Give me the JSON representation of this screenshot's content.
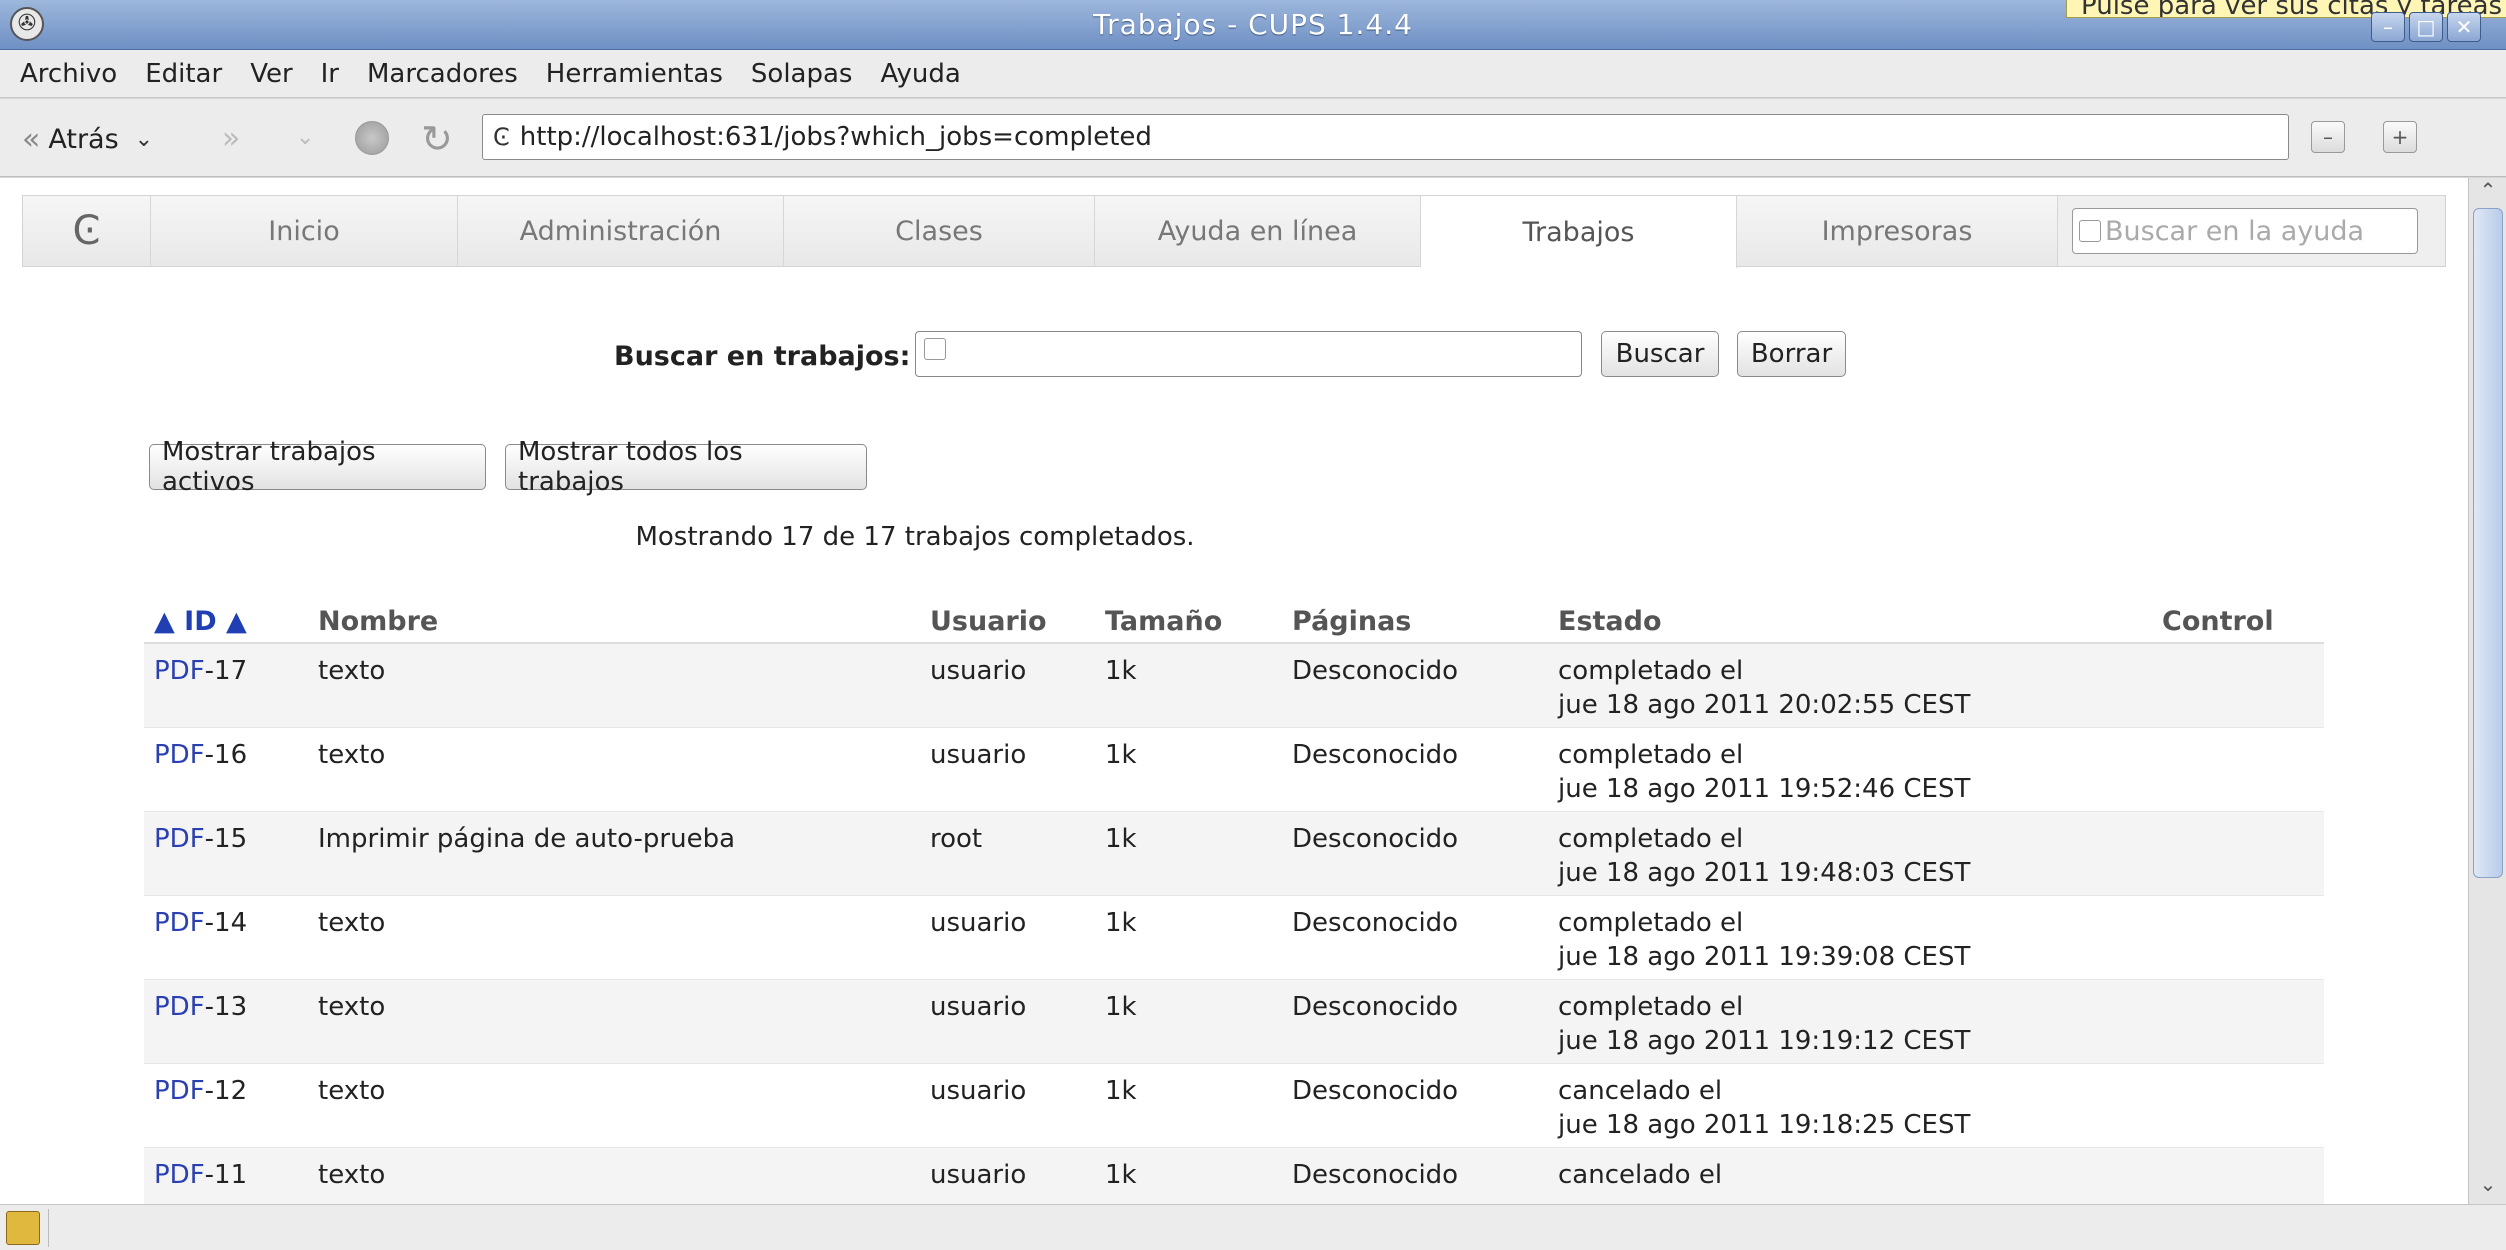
{
  "window": {
    "title": "Trabajos - CUPS 1.4.4",
    "tooltip": "Pulse para ver sus citas y tareas"
  },
  "menubar": [
    "Archivo",
    "Editar",
    "Ver",
    "Ir",
    "Marcadores",
    "Herramientas",
    "Solapas",
    "Ayuda"
  ],
  "toolbar": {
    "back_label": "Atrás",
    "url": "http://localhost:631/jobs?which_jobs=completed"
  },
  "tabs": [
    {
      "label": "Inicio",
      "active": false
    },
    {
      "label": "Administración",
      "active": false
    },
    {
      "label": "Clases",
      "active": false
    },
    {
      "label": "Ayuda en línea",
      "active": false
    },
    {
      "label": "Trabajos",
      "active": true
    },
    {
      "label": "Impresoras",
      "active": false
    }
  ],
  "help_search": {
    "placeholder": "Buscar en la ayuda"
  },
  "search": {
    "label": "Buscar en trabajos:",
    "value": "",
    "search_button": "Buscar",
    "clear_button": "Borrar"
  },
  "filters": {
    "active_jobs": "Mostrar trabajos activos",
    "all_jobs": "Mostrar todos los trabajos"
  },
  "summary": "Mostrando 17 de 17 trabajos completados.",
  "table": {
    "headers": {
      "id": "▲ ID ▲",
      "name": "Nombre",
      "user": "Usuario",
      "size": "Tamaño",
      "pages": "Páginas",
      "state": "Estado",
      "control": "Control"
    },
    "rows": [
      {
        "printer": "PDF",
        "id": "-17",
        "name": "texto",
        "user": "usuario",
        "size": "1k",
        "pages": "Desconocido",
        "state_line1": "completado el",
        "state_line2": "jue 18 ago 2011 20:02:55 CEST"
      },
      {
        "printer": "PDF",
        "id": "-16",
        "name": "texto",
        "user": "usuario",
        "size": "1k",
        "pages": "Desconocido",
        "state_line1": "completado el",
        "state_line2": "jue 18 ago 2011 19:52:46 CEST"
      },
      {
        "printer": "PDF",
        "id": "-15",
        "name": "Imprimir página de auto-prueba",
        "user": "root",
        "size": "1k",
        "pages": "Desconocido",
        "state_line1": "completado el",
        "state_line2": "jue 18 ago 2011 19:48:03 CEST"
      },
      {
        "printer": "PDF",
        "id": "-14",
        "name": "texto",
        "user": "usuario",
        "size": "1k",
        "pages": "Desconocido",
        "state_line1": "completado el",
        "state_line2": "jue 18 ago 2011 19:39:08 CEST"
      },
      {
        "printer": "PDF",
        "id": "-13",
        "name": "texto",
        "user": "usuario",
        "size": "1k",
        "pages": "Desconocido",
        "state_line1": "completado el",
        "state_line2": "jue 18 ago 2011 19:19:12 CEST"
      },
      {
        "printer": "PDF",
        "id": "-12",
        "name": "texto",
        "user": "usuario",
        "size": "1k",
        "pages": "Desconocido",
        "state_line1": "cancelado el",
        "state_line2": "jue 18 ago 2011 19:18:25 CEST"
      },
      {
        "printer": "PDF",
        "id": "-11",
        "name": "texto",
        "user": "usuario",
        "size": "1k",
        "pages": "Desconocido",
        "state_line1": "cancelado el",
        "state_line2": ""
      }
    ]
  }
}
